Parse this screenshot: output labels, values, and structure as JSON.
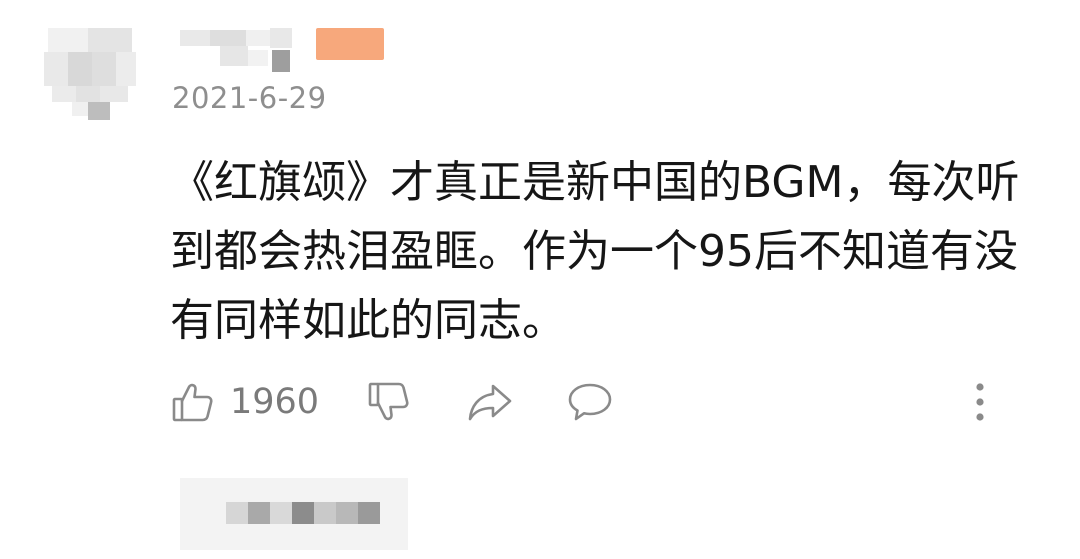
{
  "comment": {
    "author": {
      "avatar": "pixelated-avatar",
      "name": "",
      "badge_color": "#f7a87c"
    },
    "date": "2021-6-29",
    "text_lines": [
      "《红旗颂》才真正是新中国的BGM，每次听",
      "到都会热泪盈眶。作为一个95后不知道有没",
      "有同样如此的同志。"
    ],
    "actions": {
      "like_icon": "thumbs-up-icon",
      "like_count": "1960",
      "dislike_icon": "thumbs-down-icon",
      "share_icon": "share-arrow-icon",
      "reply_icon": "speech-bubble-icon",
      "more_icon": "vertical-dots-icon"
    },
    "reply_preview": "pixelated-reply"
  },
  "colors": {
    "icon_gray": "#8a8a8a",
    "date_gray": "#8e8e8e",
    "text": "#161616",
    "badge": "#f7a87c"
  }
}
